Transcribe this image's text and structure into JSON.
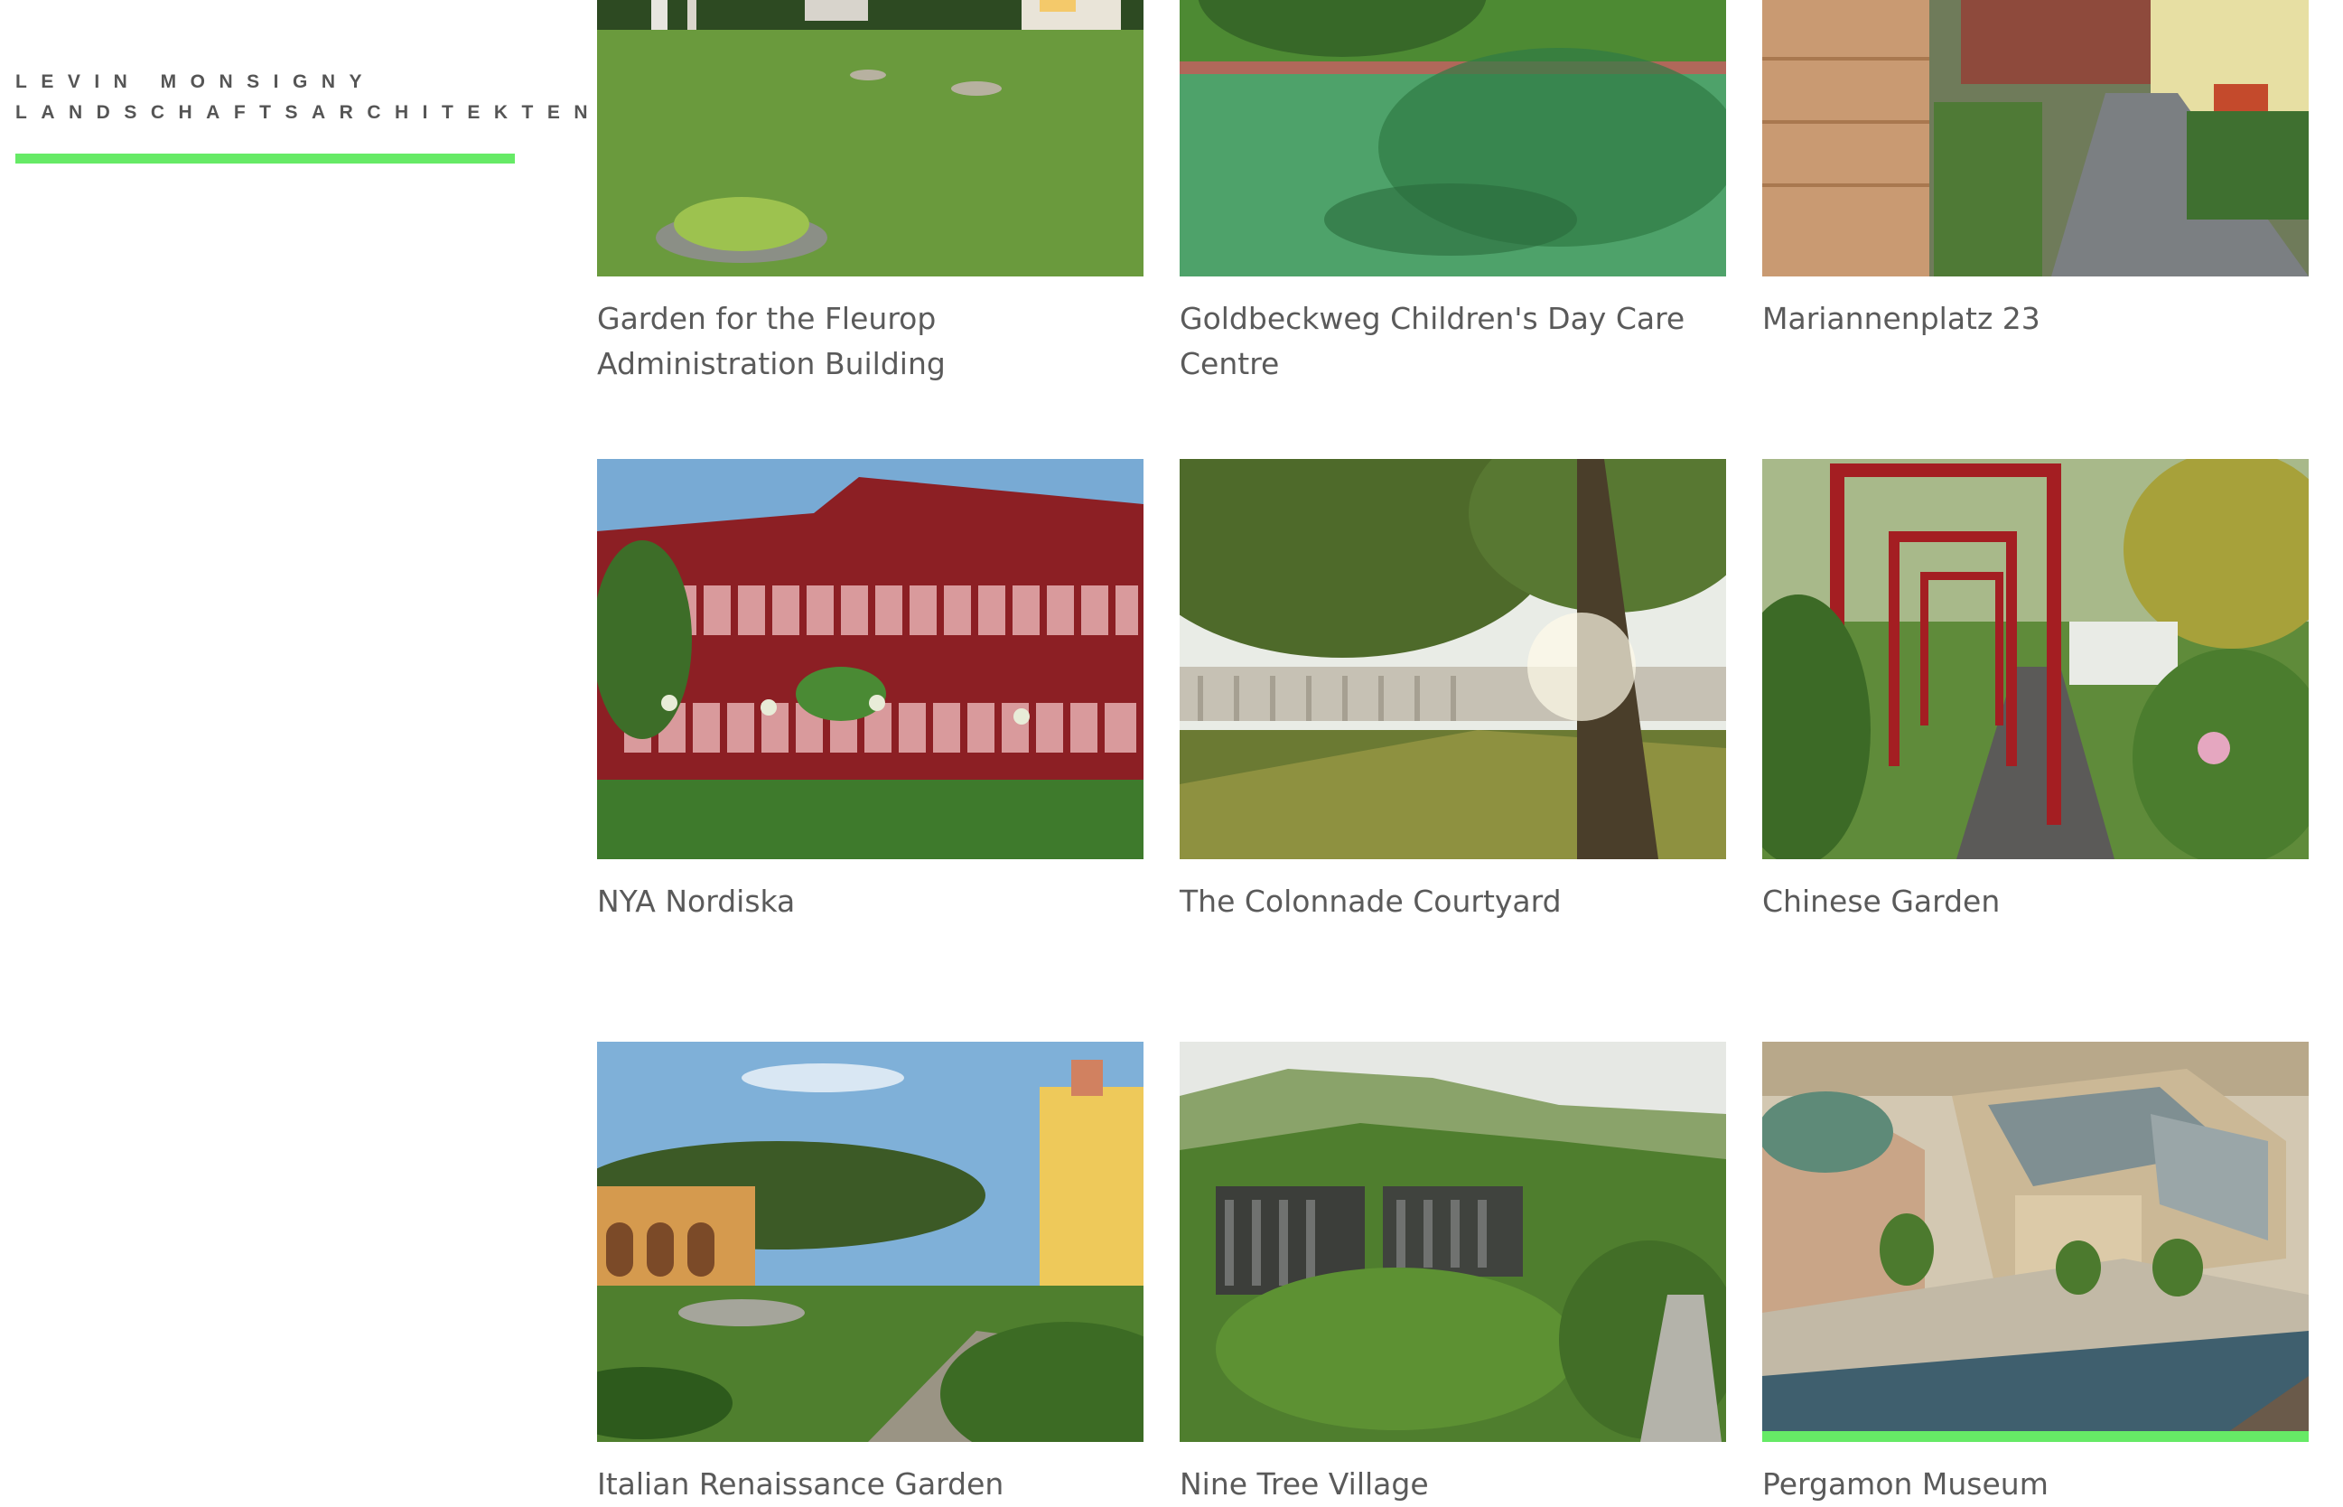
{
  "brand": {
    "line1": "LEVIN MONSIGNY",
    "line2": "LANDSCHAFTSARCHITEKTEN",
    "accent_color": "#66ea66"
  },
  "projects": [
    {
      "title": "Garden for the Fleurop Administration Building"
    },
    {
      "title": "Goldbeckweg Children's Day Care Centre"
    },
    {
      "title": "Mariannenplatz 23"
    },
    {
      "title": "NYA Nordiska"
    },
    {
      "title": "The Colonnade Courtyard"
    },
    {
      "title": "Chinese Garden"
    },
    {
      "title": "Italian Renaissance Garden"
    },
    {
      "title": "Nine Tree Village"
    },
    {
      "title": "Pergamon Museum",
      "active": true
    }
  ]
}
